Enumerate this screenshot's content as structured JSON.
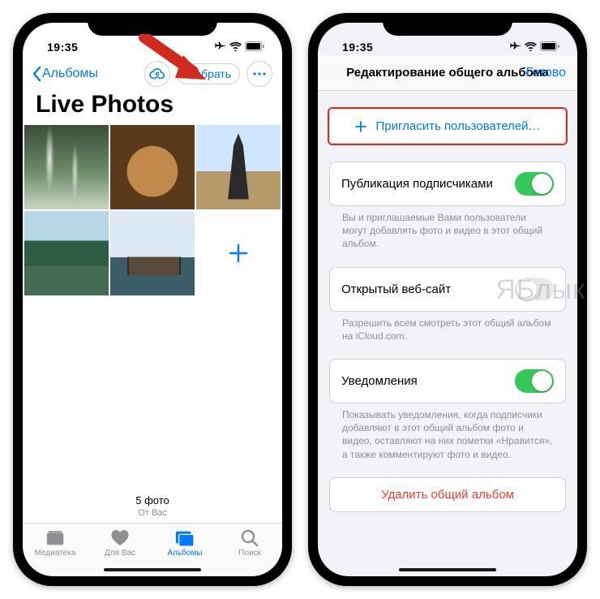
{
  "watermark": "ЯБлык",
  "left": {
    "status": {
      "time": "19:35"
    },
    "nav": {
      "back_label": "Альбомы",
      "select_label": "Выбрать"
    },
    "title": "Live Photos",
    "footer": {
      "count": "5 фото",
      "from": "От Вас"
    },
    "tabs": {
      "library": "Медиатека",
      "foryou": "Для Вас",
      "albums": "Альбомы",
      "search": "Поиск"
    }
  },
  "right": {
    "status": {
      "time": "19:35"
    },
    "nav": {
      "title": "Редактирование общего альбома",
      "done": "Готово"
    },
    "invite_label": "Пригласить пользователей…",
    "opt1": {
      "label": "Публикация подписчиками",
      "hint": "Вы и приглашаемые Вами пользователи могут добавлять фото и видео в этот общий альбом."
    },
    "opt2": {
      "label": "Открытый веб-сайт",
      "hint": "Разрешить всем смотреть этот общий альбом на iCloud.com."
    },
    "opt3": {
      "label": "Уведомления",
      "hint": "Показывать уведомления, когда подписчики добавляют в этот общий альбом фото и видео, оставляют на них пометки «Нравится», а также комментируют фото и видео."
    },
    "delete_label": "Удалить общий альбом"
  }
}
